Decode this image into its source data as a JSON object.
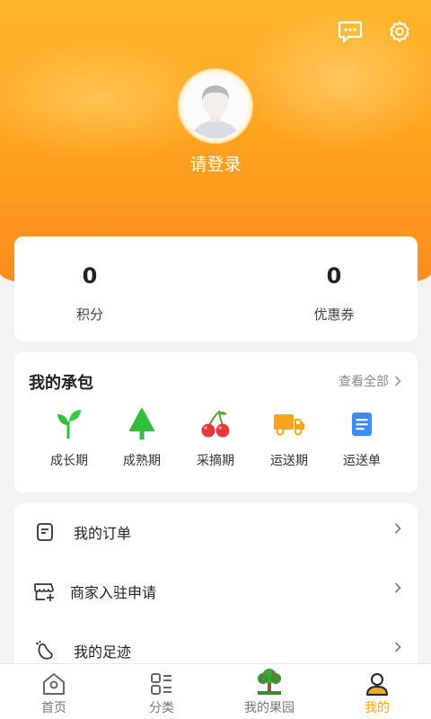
{
  "header": {
    "login_text": "请登录",
    "message_icon": "chat-bubble-icon",
    "settings_icon": "gear-icon"
  },
  "stats": [
    {
      "value": "0",
      "label": "积分"
    },
    {
      "value": "0",
      "label": "优惠券"
    }
  ],
  "contract": {
    "title": "我的承包",
    "view_all": "查看全部",
    "stages": [
      {
        "label": "成长期",
        "icon": "sprout-icon"
      },
      {
        "label": "成熟期",
        "icon": "tree-icon"
      },
      {
        "label": "采摘期",
        "icon": "cherry-icon"
      },
      {
        "label": "运送期",
        "icon": "truck-icon"
      },
      {
        "label": "运送单",
        "icon": "document-icon"
      }
    ]
  },
  "menu": [
    {
      "label": "我的订单",
      "icon": "order-icon"
    },
    {
      "label": "商家入驻申请",
      "icon": "store-add-icon"
    },
    {
      "label": "我的足迹",
      "icon": "footprint-icon"
    }
  ],
  "tabbar": [
    {
      "label": "首页",
      "icon": "home-icon"
    },
    {
      "label": "分类",
      "icon": "category-icon"
    },
    {
      "label": "我的果园",
      "icon": "orchard-tree-icon"
    },
    {
      "label": "我的",
      "icon": "user-icon",
      "active": true
    }
  ],
  "colors": {
    "accent": "#f5a623",
    "header_top": "#ffb62e",
    "header_bottom": "#fb8a1f",
    "green": "#2fbf3b",
    "red": "#e8383d",
    "blue": "#3d8bff"
  }
}
